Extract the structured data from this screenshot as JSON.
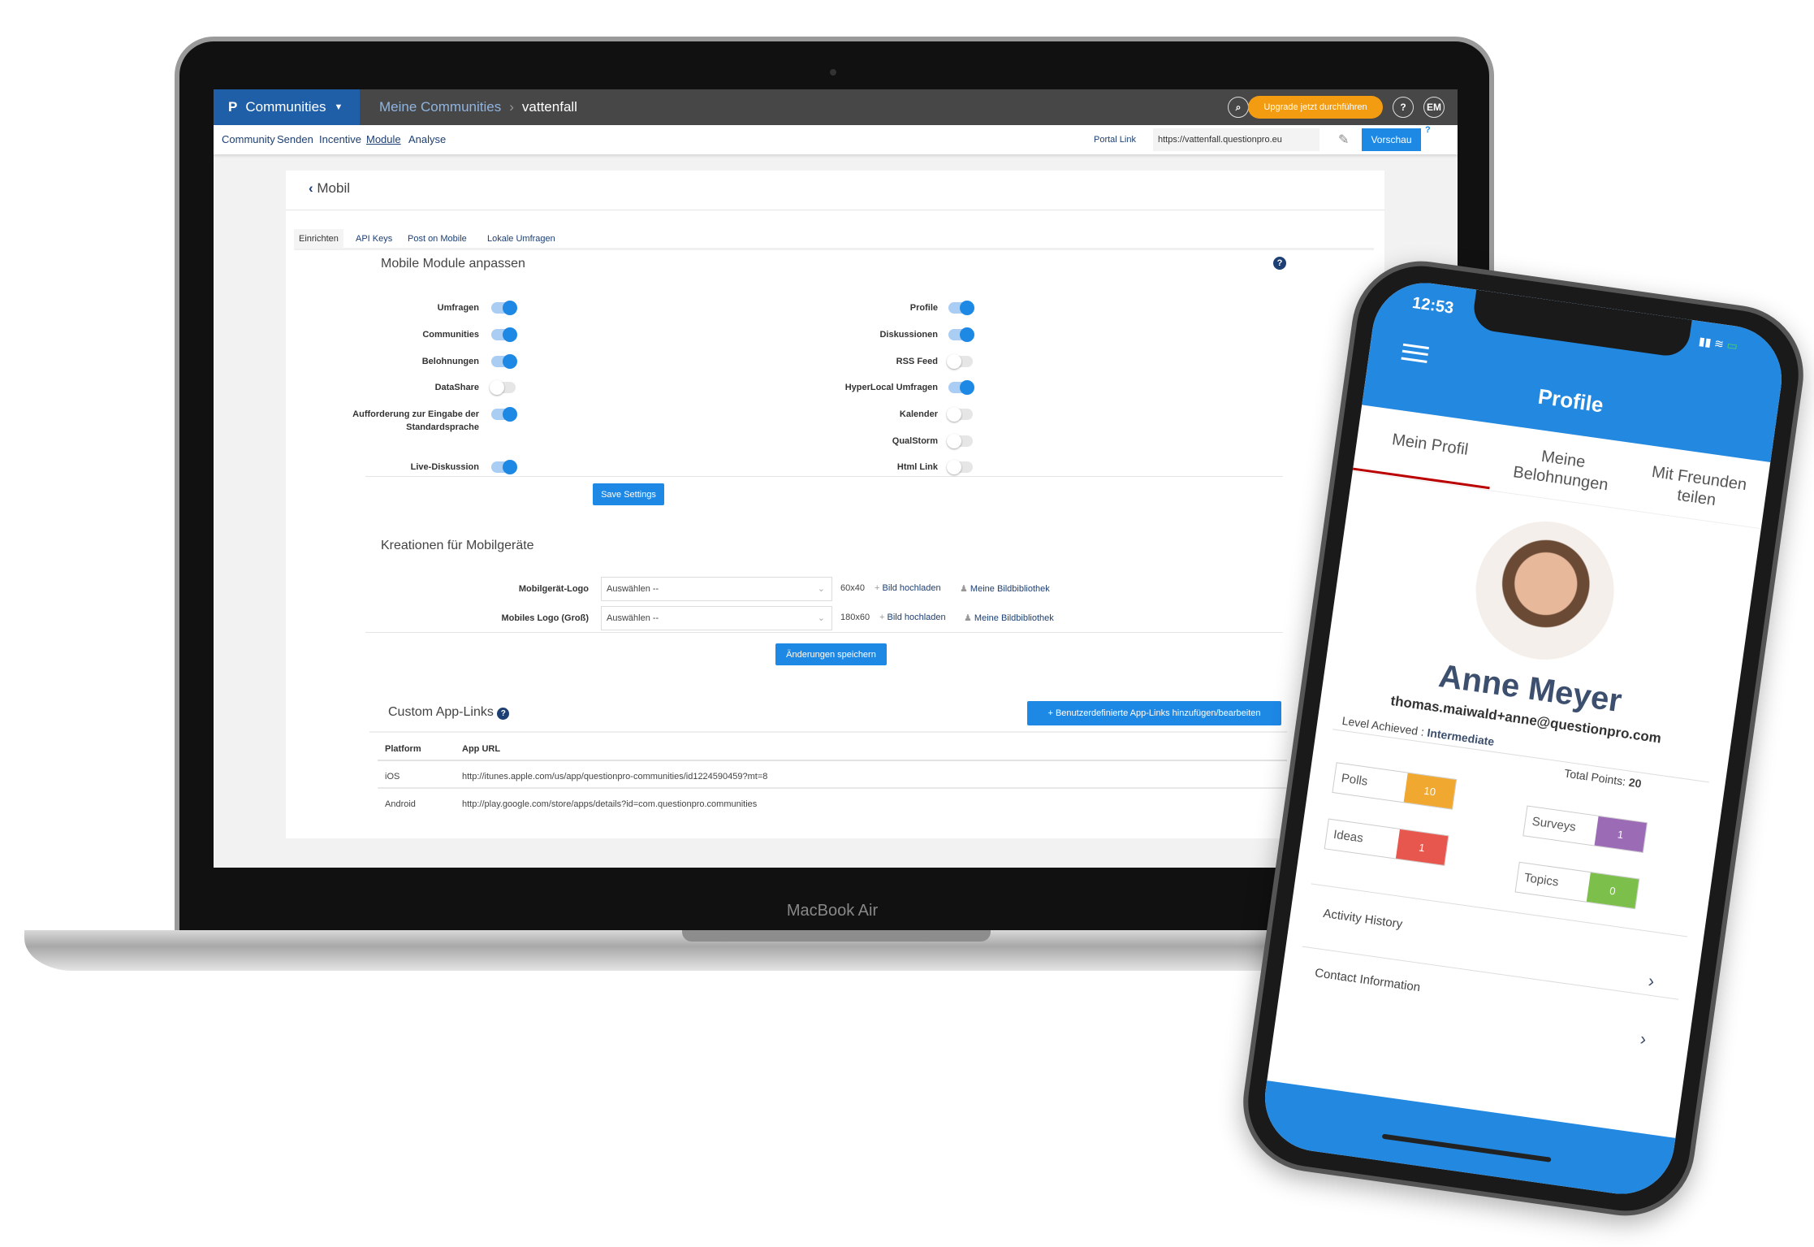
{
  "device_label": "MacBook Air",
  "topbar": {
    "product": "Communities",
    "breadcrumb_parent": "Meine Communities",
    "breadcrumb_current": "vattenfall",
    "upgrade_label": "Upgrade jetzt durchführen",
    "help": "?",
    "avatar_initials": "EM"
  },
  "nav": {
    "items": [
      "Community",
      "Senden",
      "Incentive",
      "Module",
      "Analyse"
    ],
    "active": "Module",
    "portal_link": "Portal Link",
    "portal_url": "https://vattenfall.questionpro.eu",
    "preview_label": "Vorschau"
  },
  "page": {
    "back_title": "Mobil",
    "tabs": [
      "Einrichten",
      "API Keys",
      "Post on Mobile",
      "Lokale Umfragen"
    ],
    "active_tab": "Einrichten"
  },
  "modules": {
    "title": "Mobile Module anpassen",
    "left": [
      {
        "label": "Umfragen",
        "on": true
      },
      {
        "label": "Communities",
        "on": true
      },
      {
        "label": "Belohnungen",
        "on": true
      },
      {
        "label": "DataShare",
        "on": false
      },
      {
        "label": "Aufforderung zur Eingabe der Standardsprache",
        "on": true
      },
      {
        "label": "Live-Diskussion",
        "on": true
      }
    ],
    "right": [
      {
        "label": "Profile",
        "on": true
      },
      {
        "label": "Diskussionen",
        "on": true
      },
      {
        "label": "RSS Feed",
        "on": false
      },
      {
        "label": "HyperLocal Umfragen",
        "on": true
      },
      {
        "label": "Kalender",
        "on": false
      },
      {
        "label": "QualStorm",
        "on": false
      },
      {
        "label": "Html Link",
        "on": false
      }
    ],
    "save_label": "Save Settings"
  },
  "creations": {
    "title": "Kreationen für Mobilgeräte",
    "rows": [
      {
        "label": "Mobilgerät-Logo",
        "value": "Auswählen --",
        "size": "60x40",
        "upload": "Bild hochladen",
        "library": "Meine Bildbibliothek"
      },
      {
        "label": "Mobiles Logo (Groß)",
        "value": "Auswählen --",
        "size": "180x60",
        "upload": "Bild hochladen",
        "library": "Meine Bildbibliothek"
      }
    ],
    "save_label": "Änderungen speichern"
  },
  "applinks": {
    "title": "Custom App-Links",
    "add_label": "Benutzerdefinierte App-Links hinzufügen/bearbeiten",
    "columns": [
      "Platform",
      "App URL"
    ],
    "rows": [
      [
        "iOS",
        "http://itunes.apple.com/us/app/questionpro-communities/id1224590459?mt=8"
      ],
      [
        "Android",
        "http://play.google.com/store/apps/details?id=com.questionpro.communities"
      ]
    ]
  },
  "phone": {
    "time": "12:53",
    "title": "Profile",
    "tabs": [
      "Mein Profil",
      "Meine Belohnungen",
      "Mit Freunden teilen"
    ],
    "name": "Anne Meyer",
    "email": "thomas.maiwald+anne@questionpro.com",
    "level_label": "Level Achieved :",
    "level": "Intermediate",
    "points_label": "Total Points:",
    "points": "20",
    "stats": [
      {
        "label": "Polls",
        "value": "10",
        "color": "#f0a830"
      },
      {
        "label": "Surveys",
        "value": "1",
        "color": "#9b6bb5"
      },
      {
        "label": "Ideas",
        "value": "1",
        "color": "#e8574e"
      },
      {
        "label": "Topics",
        "value": "0",
        "color": "#7cc04b"
      }
    ],
    "list": [
      "Activity History",
      "Contact Information"
    ]
  },
  "colors": {
    "brand_blue": "#1f5fa8",
    "accent": "#1e88e5",
    "upgrade": "#f39c12",
    "phone_blue": "#2388e0"
  }
}
